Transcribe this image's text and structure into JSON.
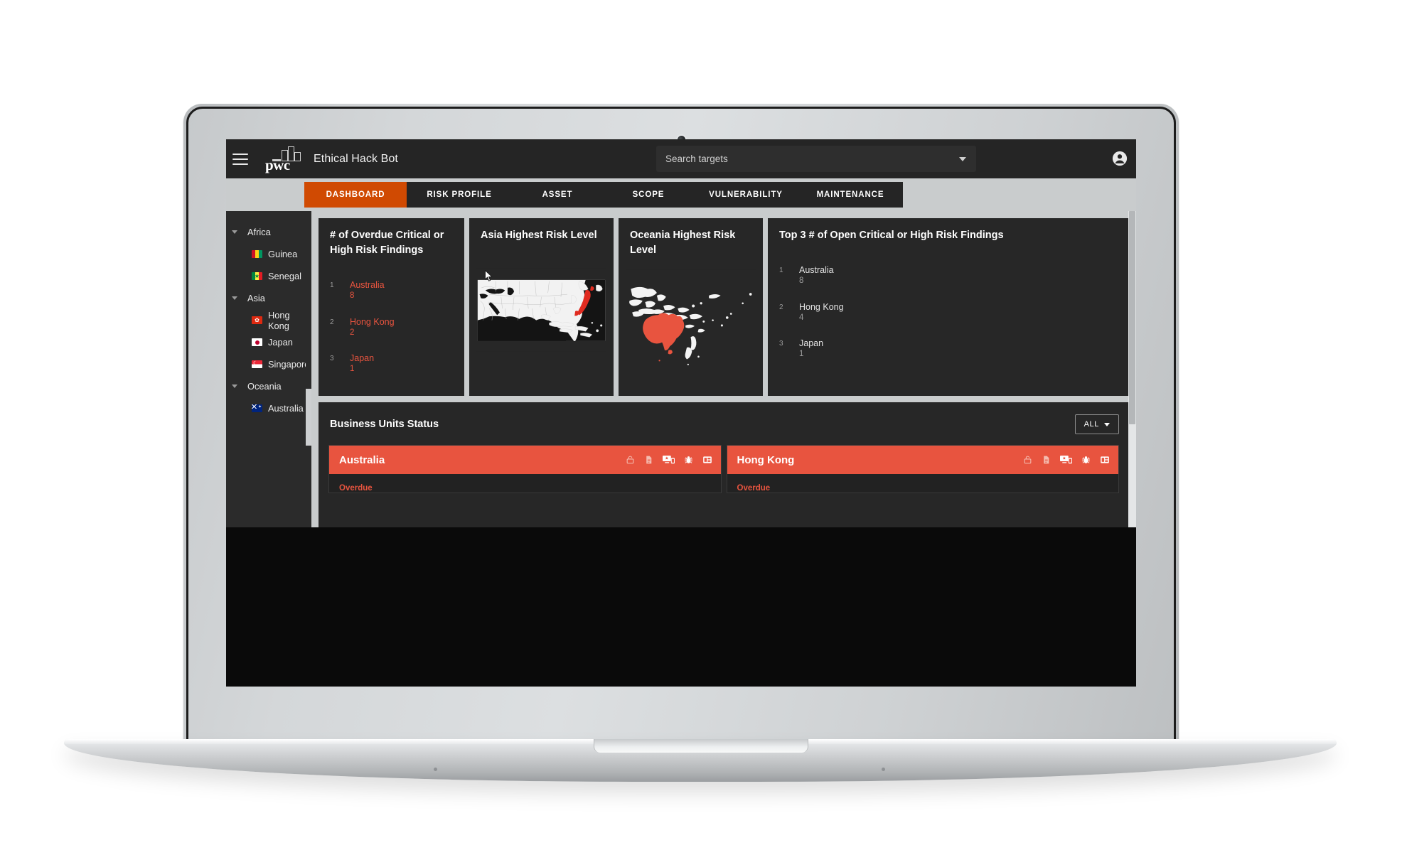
{
  "app": {
    "brand": "pwc",
    "title": "Ethical Hack Bot",
    "menu_icon": "hamburger-icon",
    "account_icon": "account-circle-icon"
  },
  "search": {
    "placeholder": "Search targets",
    "value": "",
    "dropdown_icon": "chevron-down-icon"
  },
  "nav": {
    "tabs": [
      {
        "label": "DASHBOARD",
        "active": true
      },
      {
        "label": "RISK PROFILE",
        "active": false
      },
      {
        "label": "ASSET",
        "active": false
      },
      {
        "label": "SCOPE",
        "active": false
      },
      {
        "label": "VULNERABILITY",
        "active": false
      },
      {
        "label": "MAINTENANCE",
        "active": false
      }
    ]
  },
  "sidebar": {
    "groups": [
      {
        "label": "Africa",
        "expanded": true,
        "items": [
          {
            "label": "Guinea",
            "flag": "flag-guinea"
          },
          {
            "label": "Senegal",
            "flag": "flag-senegal"
          }
        ]
      },
      {
        "label": "Asia",
        "expanded": true,
        "items": [
          {
            "label": "Hong Kong",
            "flag": "flag-hk"
          },
          {
            "label": "Japan",
            "flag": "flag-japan"
          },
          {
            "label": "Singapore",
            "flag": "flag-sg"
          }
        ]
      },
      {
        "label": "Oceania",
        "expanded": true,
        "items": [
          {
            "label": "Australia",
            "flag": "flag-au"
          }
        ]
      }
    ]
  },
  "cards": {
    "overdue_findings": {
      "title": "# of Overdue Critical or High Risk Findings",
      "rows": [
        {
          "rank": "1",
          "name": "Australia",
          "value": "8"
        },
        {
          "rank": "2",
          "name": "Hong Kong",
          "value": "2"
        },
        {
          "rank": "3",
          "name": "Japan",
          "value": "1"
        }
      ]
    },
    "asia_map": {
      "title": "Asia Highest Risk Level",
      "highlighted_country": "Japan",
      "highlight_color": "#e02b20"
    },
    "oceania_map": {
      "title": "Oceania Highest Risk Level",
      "highlighted_country": "Australia",
      "highlight_color": "#e8543f"
    },
    "open_findings": {
      "title": "Top 3 # of Open Critical or High Risk Findings",
      "rows": [
        {
          "rank": "1",
          "name": "Australia",
          "value": "8"
        },
        {
          "rank": "2",
          "name": "Hong Kong",
          "value": "4"
        },
        {
          "rank": "3",
          "name": "Japan",
          "value": "1"
        }
      ]
    }
  },
  "business_units": {
    "title": "Business Units Status",
    "filter_label": "ALL",
    "status_label": "Overdue",
    "icons": [
      "unlock-icon",
      "document-icon",
      "devices-icon",
      "bug-icon",
      "dashboard-icon"
    ],
    "units": [
      {
        "name": "Australia",
        "status": "Overdue"
      },
      {
        "name": "Hong Kong",
        "status": "Overdue"
      }
    ]
  },
  "colors": {
    "brand_orange": "#d04a02",
    "alert_red": "#e8543f",
    "panel_dark": "#272727",
    "header_dark": "#252525",
    "app_bg": "#c9cccd"
  }
}
